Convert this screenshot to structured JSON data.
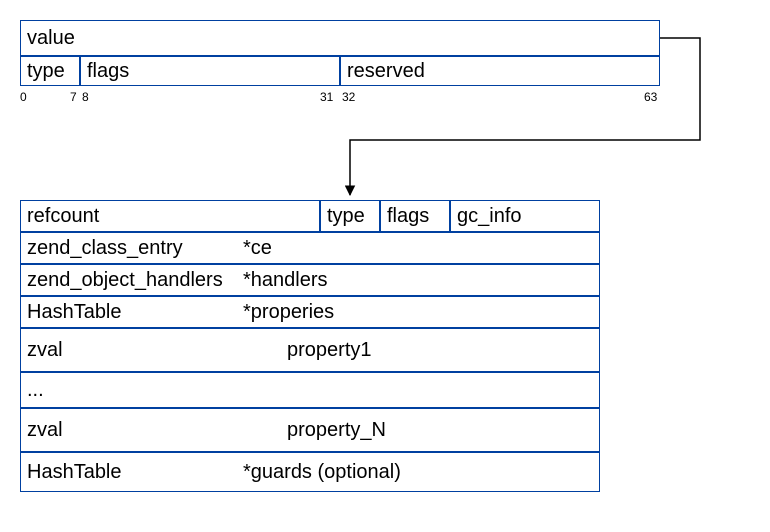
{
  "zval": {
    "value": "value",
    "type": "type",
    "flags": "flags",
    "reserved": "reserved",
    "bits": {
      "b0": "0",
      "b7": "7",
      "b8": "8",
      "b31": "31",
      "b32": "32",
      "b63": "63"
    }
  },
  "obj": {
    "header": {
      "refcount": "refcount",
      "type": "type",
      "flags": "flags",
      "gc_info": "gc_info"
    },
    "rows": {
      "ce": {
        "type": "zend_class_entry",
        "name": "*ce"
      },
      "handlers": {
        "type": "zend_object_handlers",
        "name": "*handlers"
      },
      "props": {
        "type": "HashTable",
        "name": "*properies"
      },
      "prop1": {
        "type": "zval",
        "name": "property1"
      },
      "ellipsis": "...",
      "propN": {
        "type": "zval",
        "name": "property_N"
      },
      "guards": {
        "type": "HashTable",
        "name": "*guards (optional)"
      }
    }
  }
}
